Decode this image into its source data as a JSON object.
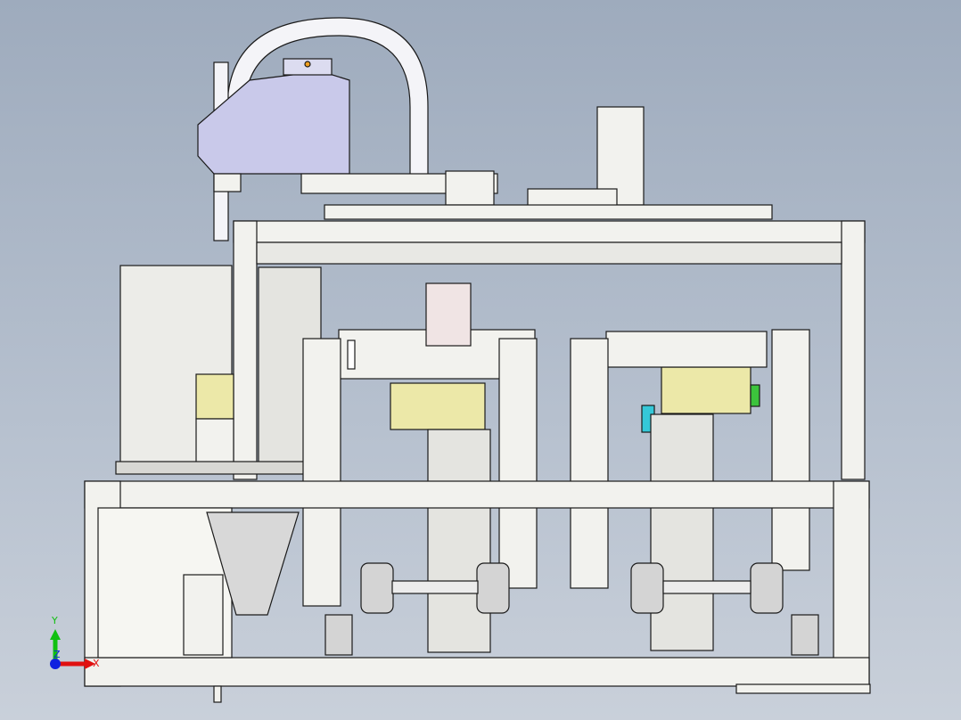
{
  "viewport": {
    "background_top": "#9eabbd",
    "background_bottom": "#c9d0da",
    "model_colors": {
      "frame": "#f2f2ee",
      "outline": "#1a1a1a",
      "robot_body": "#c9c9ea",
      "mount_plate": "#ece8a8",
      "cyan_part": "#35c8d8",
      "green_part": "#3cc43c",
      "orange_indicator": "#f0a020"
    }
  },
  "triad": {
    "x_label": "X",
    "y_label": "Y",
    "z_label": "Z",
    "x_color": "#e01010",
    "y_color": "#10c010",
    "z_color": "#1020e0"
  }
}
